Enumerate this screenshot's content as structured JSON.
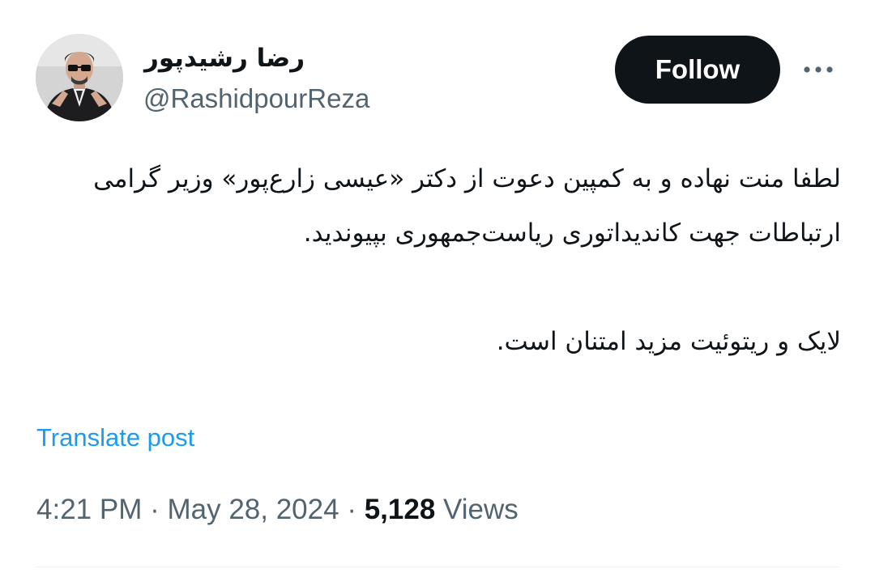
{
  "user": {
    "display_name": "رضا رشیدپور",
    "handle": "@RashidpourReza"
  },
  "header": {
    "follow_label": "Follow",
    "more_icon": "more-horizontal-icon"
  },
  "tweet": {
    "paragraphs": [
      "لطفا منت نهاده و به کمپین دعوت از دکتر «عیسی زارع‌پور» وزیر گرامی ارتباطات جهت کاندیداتوری ریاست‌جمهوری بپیوندید.",
      "لایک و ریتوئیت مزید امتنان است."
    ],
    "translate_label": "Translate post"
  },
  "meta": {
    "time": "4:21 PM",
    "separator": "·",
    "date": "May 28, 2024",
    "views_count": "5,128",
    "views_label": "Views"
  },
  "colors": {
    "text": "#0f1419",
    "secondary": "#536471",
    "link": "#1d9bf0",
    "button_bg": "#0f1419",
    "button_text": "#ffffff"
  }
}
